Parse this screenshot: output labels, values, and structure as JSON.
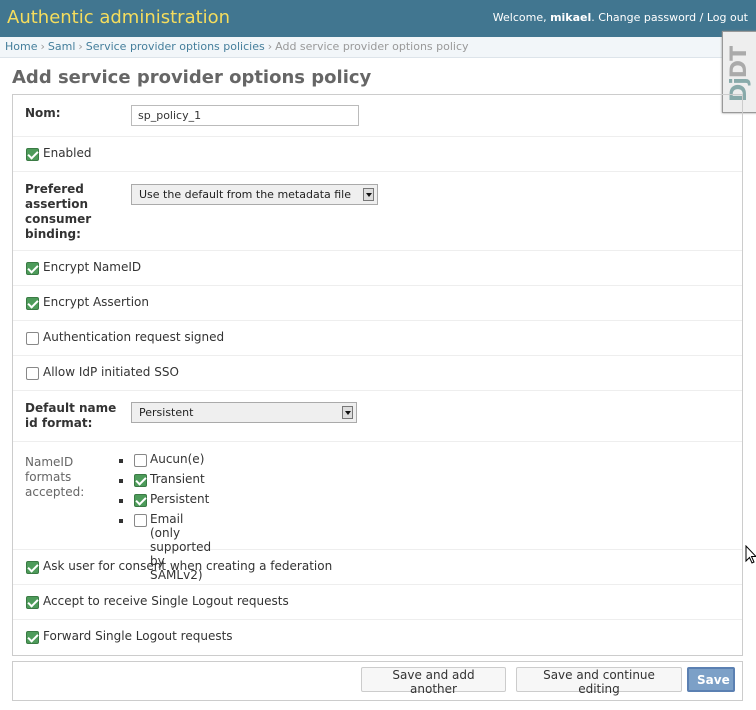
{
  "header": {
    "brand": "Authentic administration",
    "welcome": "Welcome, ",
    "username": "mikael",
    "change_password": "Change password",
    "separator": " / ",
    "logout": "Log out"
  },
  "breadcrumbs": {
    "home": "Home",
    "saml": "Saml",
    "policies": "Service provider options policies",
    "current": "Add service provider options policy"
  },
  "debug_toolbar": {
    "handle_text": "DjDT"
  },
  "page_title": "Add service provider options policy",
  "form": {
    "name": {
      "label": "Nom:",
      "value": "sp_policy_1"
    },
    "enabled": {
      "label": "Enabled",
      "checked": true
    },
    "binding": {
      "label_line1": "Prefered",
      "label_line2": "assertion",
      "label_line3": "consumer",
      "label_line4": "binding:",
      "selected": "Use the default from the metadata file"
    },
    "encrypt_nameid": {
      "label": "Encrypt NameID",
      "checked": true
    },
    "encrypt_assertion": {
      "label": "Encrypt Assertion",
      "checked": true
    },
    "authn_request_signed": {
      "label": "Authentication request signed",
      "checked": false
    },
    "idp_initiated_sso": {
      "label": "Allow IdP initiated SSO",
      "checked": false
    },
    "default_nameid": {
      "label_line1": "Default name",
      "label_line2": "id format:",
      "selected": "Persistent"
    },
    "nameid_formats": {
      "label_line1": "NameID",
      "label_line2": "formats",
      "label_line3": "accepted:",
      "options": [
        {
          "label": "Aucun(e)",
          "checked": false
        },
        {
          "label": "Transient",
          "checked": true
        },
        {
          "label": "Persistent",
          "checked": true
        },
        {
          "label": "Email (only supported by SAMLv2)",
          "checked": false
        }
      ]
    },
    "ask_consent": {
      "label": "Ask user for consent when creating a federation",
      "checked": true
    },
    "accept_slo": {
      "label": "Accept to receive Single Logout requests",
      "checked": true
    },
    "forward_slo": {
      "label": "Forward Single Logout requests",
      "checked": true
    }
  },
  "submit": {
    "save_add_another": "Save and add another",
    "save_continue": "Save and continue editing",
    "save": "Save"
  },
  "colors": {
    "header_bg": "#417690",
    "brand": "#f5dd5d",
    "link": "#447e9b",
    "checkbox_on": "#4d9b5a",
    "save_button": "#7ca0c7"
  }
}
